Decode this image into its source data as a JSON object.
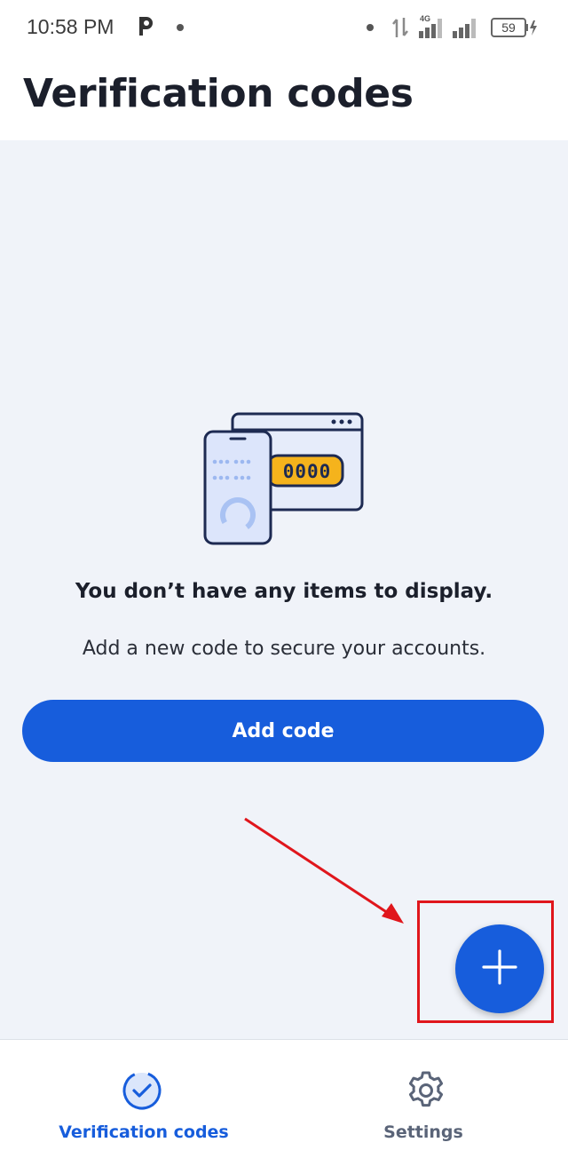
{
  "status_bar": {
    "time": "10:58 PM",
    "network_type": "4G",
    "battery_level": "59",
    "icons": [
      "p-app-icon",
      "notification-dot-icon",
      "data-arrows-icon",
      "signal-4g-icon",
      "signal-icon",
      "battery-charging-icon"
    ]
  },
  "header": {
    "title": "Verification codes"
  },
  "empty_state": {
    "illustration_code": "0000",
    "title": "You don’t have any items to display.",
    "subtitle": "Add a new code to secure your accounts.",
    "add_button_label": "Add code"
  },
  "fab": {
    "icon": "plus-icon"
  },
  "bottom_nav": {
    "items": [
      {
        "label": "Verification codes",
        "icon": "verification-check-icon",
        "active": true
      },
      {
        "label": "Settings",
        "icon": "gear-icon",
        "active": false
      }
    ]
  },
  "colors": {
    "primary": "#175ddc",
    "content_background": "#f0f3f9",
    "annotation_red": "#e0161c",
    "inactive_nav": "#5a6478",
    "illustration_yellow": "#f5b31c"
  }
}
